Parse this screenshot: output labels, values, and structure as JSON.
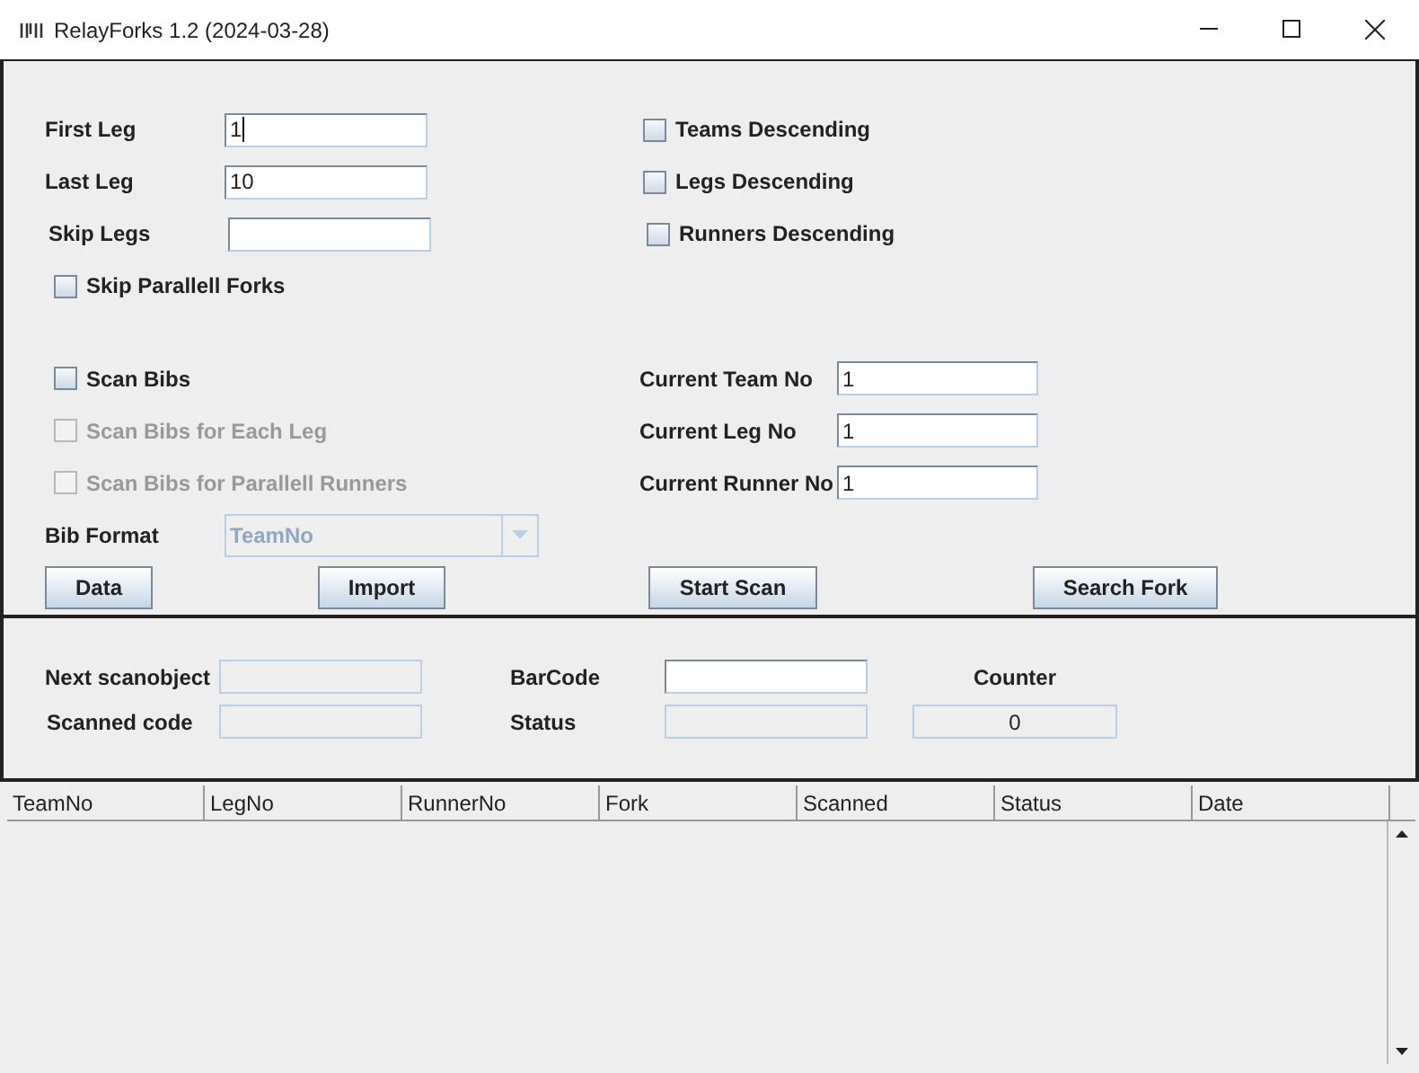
{
  "window": {
    "title": "RelayForks 1.2 (2024-03-28)"
  },
  "leg_fields": [
    {
      "label": "First Leg",
      "value": "1",
      "focused": true
    },
    {
      "label": "Last Leg",
      "value": "10",
      "focused": false
    },
    {
      "label": "Skip Legs",
      "focused": false
    }
  ],
  "sort_options": [
    {
      "label": "Teams Descending",
      "checked": false
    },
    {
      "label": "Legs Descending",
      "checked": false
    },
    {
      "label": "Runners Descending",
      "checked": false
    }
  ],
  "skip_parallel_forks": {
    "label": "Skip Parallell Forks",
    "checked": false
  },
  "scan_options": [
    {
      "label": "Scan Bibs",
      "checked": false,
      "disabled": false
    },
    {
      "label": "Scan Bibs for Each Leg",
      "checked": false,
      "disabled": true
    },
    {
      "label": "Scan Bibs for Parallell Runners",
      "checked": false,
      "disabled": true
    }
  ],
  "current_fields": [
    {
      "label": "Current Team No",
      "value": "1"
    },
    {
      "label": "Current Leg No",
      "value": "1"
    },
    {
      "label": "Current Runner No",
      "value": "1"
    }
  ],
  "bib_format": {
    "label": "Bib Format",
    "value": "TeamNo",
    "disabled": true
  },
  "buttons": [
    "Data",
    "Import",
    "Start Scan",
    "Search Fork"
  ],
  "scan_panel": {
    "next_label": "Next scanobject",
    "scanned_label": "Scanned code",
    "barcode_label": "BarCode",
    "status_label": "Status",
    "counter_label": "Counter",
    "counter_value": "0"
  },
  "table": {
    "columns": [
      "TeamNo",
      "LegNo",
      "RunnerNo",
      "Fork",
      "Scanned",
      "Status",
      "Date"
    ]
  }
}
